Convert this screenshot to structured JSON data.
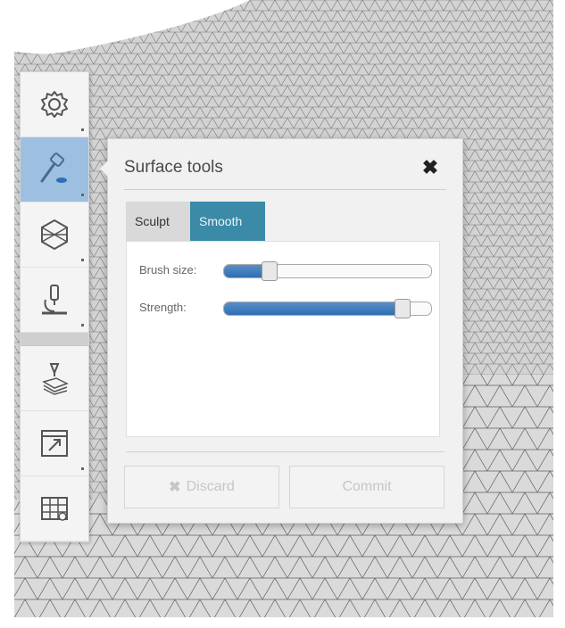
{
  "panel": {
    "title": "Surface tools",
    "close_glyph": "✖",
    "tabs": [
      {
        "label": "Sculpt",
        "active": false
      },
      {
        "label": "Smooth",
        "active": true
      }
    ],
    "sliders": [
      {
        "label": "Brush size:",
        "value_fraction": 0.22
      },
      {
        "label": "Strength:",
        "value_fraction": 0.86
      }
    ],
    "buttons": {
      "discard_icon": "✖",
      "discard_label": "Discard",
      "commit_label": "Commit"
    }
  },
  "toolbar": {
    "items": [
      {
        "icon": "gear-icon"
      },
      {
        "icon": "hammer-icon",
        "active": true
      },
      {
        "icon": "hexagon-mesh-icon"
      },
      {
        "icon": "microscope-icon"
      },
      {
        "icon": "print-layers-icon"
      },
      {
        "icon": "export-window-icon"
      },
      {
        "icon": "grid-table-icon"
      }
    ]
  },
  "colors": {
    "active_tab": "#3a8aa8",
    "active_tool": "#9dbfe0",
    "slider_fill": "#2f6fb2"
  }
}
